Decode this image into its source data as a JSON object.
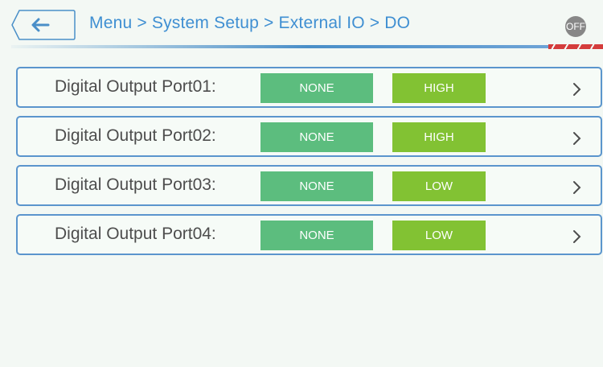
{
  "header": {
    "breadcrumb": "Menu > System Setup > External IO > DO",
    "status_badge": "OFF"
  },
  "rows": [
    {
      "label": "Digital Output Port01:",
      "source": "NONE",
      "level": "HIGH"
    },
    {
      "label": "Digital Output Port02:",
      "source": "NONE",
      "level": "HIGH"
    },
    {
      "label": "Digital Output Port03:",
      "source": "NONE",
      "level": "LOW"
    },
    {
      "label": "Digital Output Port04:",
      "source": "NONE",
      "level": "LOW"
    }
  ],
  "colors": {
    "accent": "#3f8fd2",
    "source_button": "#5cbd7e",
    "level_button": "#82c233",
    "row_border": "#5b95cd"
  },
  "icons": {
    "back": "left-arrow-icon",
    "row_next": "chevron-right-icon"
  }
}
